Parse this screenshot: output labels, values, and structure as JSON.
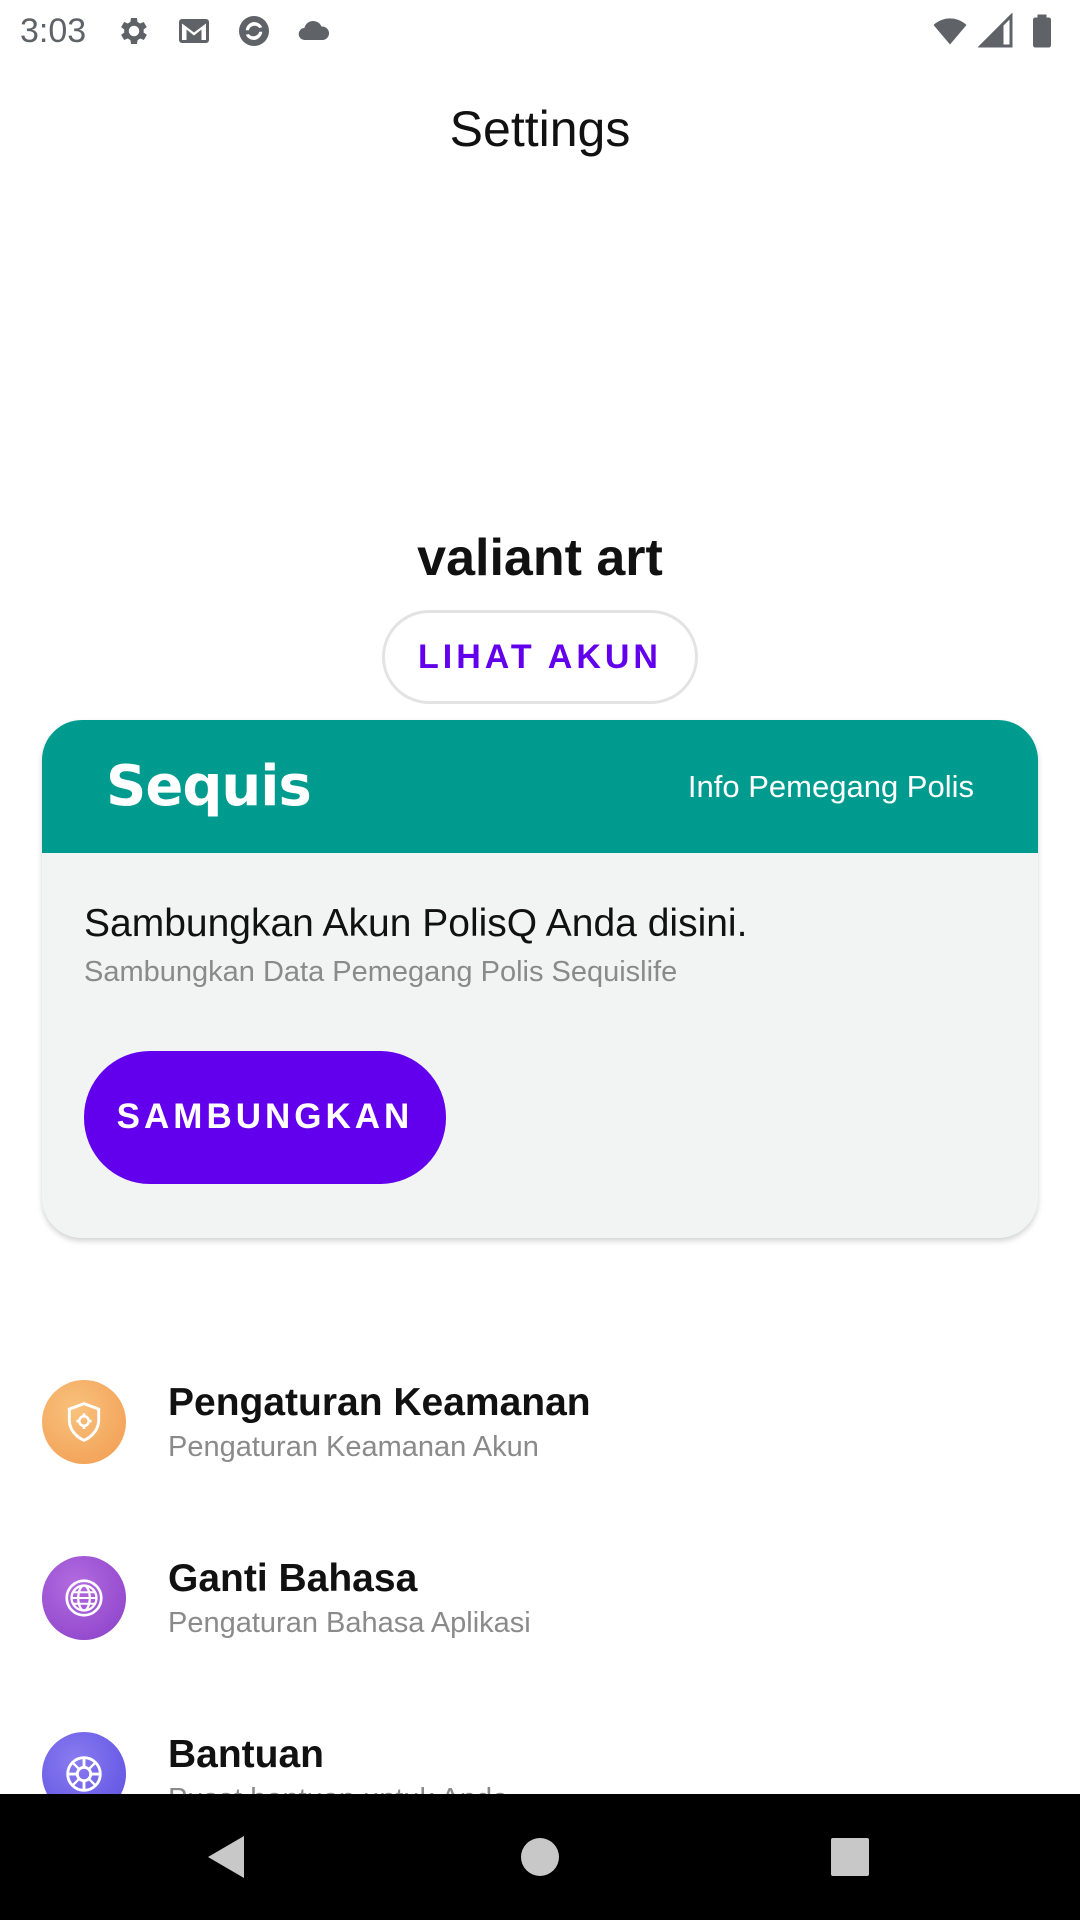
{
  "status_bar": {
    "time": "3:03",
    "icons": [
      "gear-icon",
      "gmail-icon",
      "sync-icon",
      "cloud-icon",
      "wifi-icon",
      "signal-icon",
      "battery-icon"
    ]
  },
  "app_bar": {
    "title": "Settings"
  },
  "profile": {
    "name": "valiant art",
    "view_account_label": "LIHAT AKUN"
  },
  "sequis_card": {
    "logo": "Sequis",
    "header_info": "Info Pemegang Polis",
    "title": "Sambungkan Akun PolisQ Anda disini.",
    "subtitle": "Sambungkan Data Pemegang Polis Sequislife",
    "connect_label": "SAMBUNGKAN",
    "header_color": "#009b8f",
    "button_color": "#6200ee"
  },
  "settings": [
    {
      "title": "Pengaturan Keamanan",
      "subtitle": "Pengaturan Keamanan Akun",
      "icon": "security-shield-icon",
      "color": "#f5a65b"
    },
    {
      "title": "Ganti Bahasa",
      "subtitle": "Pengaturan Bahasa Aplikasi",
      "icon": "globe-language-icon",
      "color": "#9b4fd1"
    },
    {
      "title": "Bantuan",
      "subtitle": "Pusat bantuan untuk Anda",
      "icon": "help-lifebuoy-icon",
      "color": "#6a5ee8"
    }
  ],
  "nav_bar": {
    "buttons": [
      "back-icon",
      "home-icon",
      "recents-icon"
    ]
  }
}
